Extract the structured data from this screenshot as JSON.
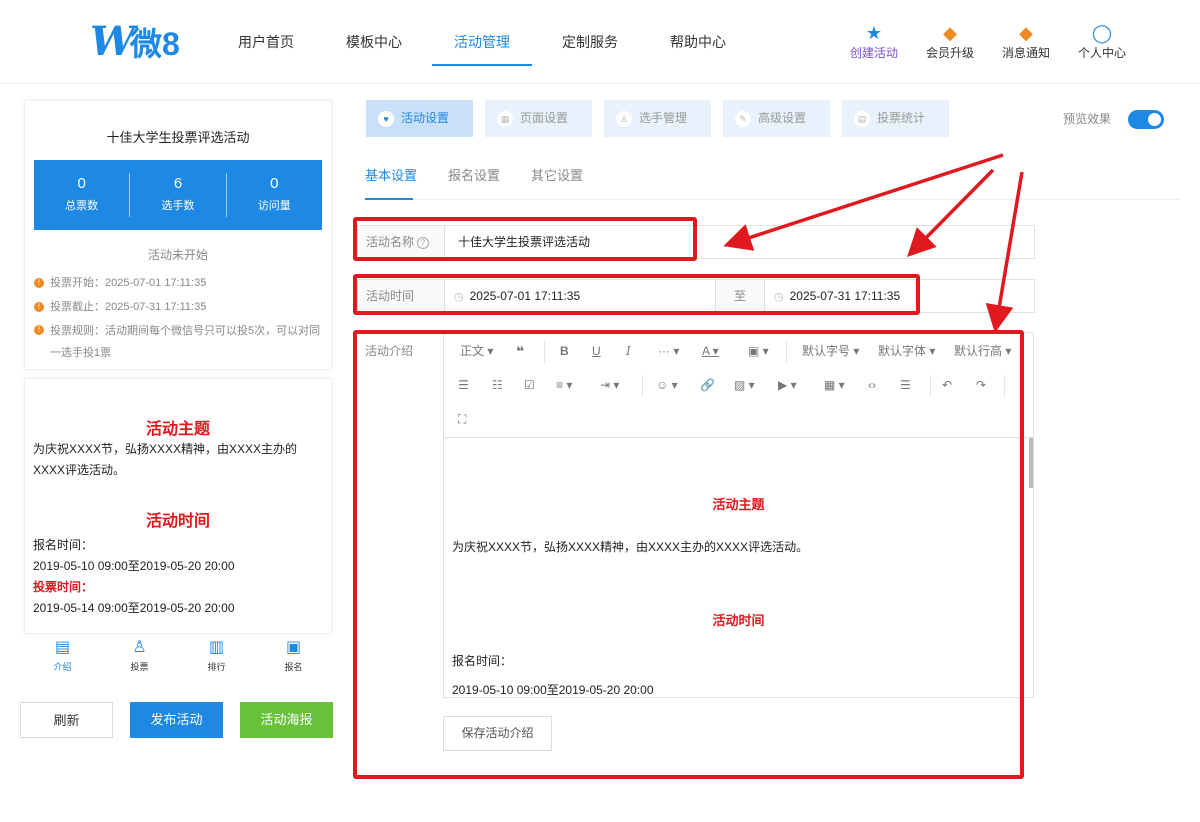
{
  "brand": {
    "logo_text": "微8"
  },
  "nav": {
    "items": [
      {
        "label": "用户首页"
      },
      {
        "label": "模板中心"
      },
      {
        "label": "活动管理"
      },
      {
        "label": "定制服务"
      },
      {
        "label": "帮助中心"
      }
    ]
  },
  "header_icons": [
    {
      "label": "创建活动",
      "icon": "★"
    },
    {
      "label": "会员升级",
      "icon": "◆"
    },
    {
      "label": "消息通知",
      "icon": "◆"
    },
    {
      "label": "个人中心",
      "icon": "◯"
    }
  ],
  "preview_card": {
    "title": "十佳大学生投票评选活动",
    "stats": [
      {
        "value": "0",
        "label": "总票数"
      },
      {
        "value": "6",
        "label": "选手数"
      },
      {
        "value": "0",
        "label": "访问量"
      }
    ],
    "status": "活动未开始",
    "vote_start": "投票开始：2025-07-01 17:11:35",
    "vote_end": "投票截止：2025-07-31 17:11:35",
    "vote_rule": "投票规则：活动期间每个微信号只可以投5次，可以对同一选手投1票"
  },
  "preview_intro": {
    "theme_heading": "活动主题",
    "theme_text": "为庆祝XXXX节，弘扬XXXX精神，由XXXX主办的XXXX评选活动。",
    "time_heading": "活动时间",
    "signup_label": "报名时间：",
    "signup_time": "2019-05-10 09:00至2019-05-20 20:00",
    "vote_label": "投票时间：",
    "vote_time": "2019-05-14 09:00至2019-05-20 20:00"
  },
  "bottom_nav": [
    {
      "label": "介绍",
      "icon": "▤"
    },
    {
      "label": "投票",
      "icon": "♙"
    },
    {
      "label": "排行",
      "icon": "▥"
    },
    {
      "label": "报名",
      "icon": "▣"
    }
  ],
  "actions": {
    "refresh": "刷新",
    "publish": "发布活动",
    "poster": "活动海报"
  },
  "tabs": [
    {
      "label": "活动设置",
      "icon": "♥"
    },
    {
      "label": "页面设置",
      "icon": "▦"
    },
    {
      "label": "选手管理",
      "icon": "♙"
    },
    {
      "label": "高级设置",
      "icon": "✎"
    },
    {
      "label": "投票统计",
      "icon": "▤"
    }
  ],
  "preview_toggle": {
    "label": "预览效果",
    "on": true
  },
  "subtabs": [
    {
      "label": "基本设置"
    },
    {
      "label": "报名设置"
    },
    {
      "label": "其它设置"
    }
  ],
  "form": {
    "name_label": "活动名称",
    "name_value": "十佳大学生投票评选活动",
    "time_label": "活动时间",
    "time_start": "2025-07-01 17:11:35",
    "time_sep": "至",
    "time_end": "2025-07-31 17:11:35",
    "intro_label": "活动介绍"
  },
  "toolbar": {
    "paragraph": "正文",
    "font_size": "默认字号",
    "font_family": "默认字体",
    "line_height": "默认行高"
  },
  "editor_content": {
    "theme_heading": "活动主题",
    "theme_text": "为庆祝XXXX节，弘扬XXXX精神，由XXXX主办的XXXX评选活动。",
    "time_heading": "活动时间",
    "signup_label": "报名时间：",
    "signup_time": "2019-05-10 09:00至2019-05-20 20:00"
  },
  "save_button": "保存活动介绍",
  "colors": {
    "accent": "#1e88e5",
    "highlight": "#e0191f",
    "green": "#67c23a"
  }
}
